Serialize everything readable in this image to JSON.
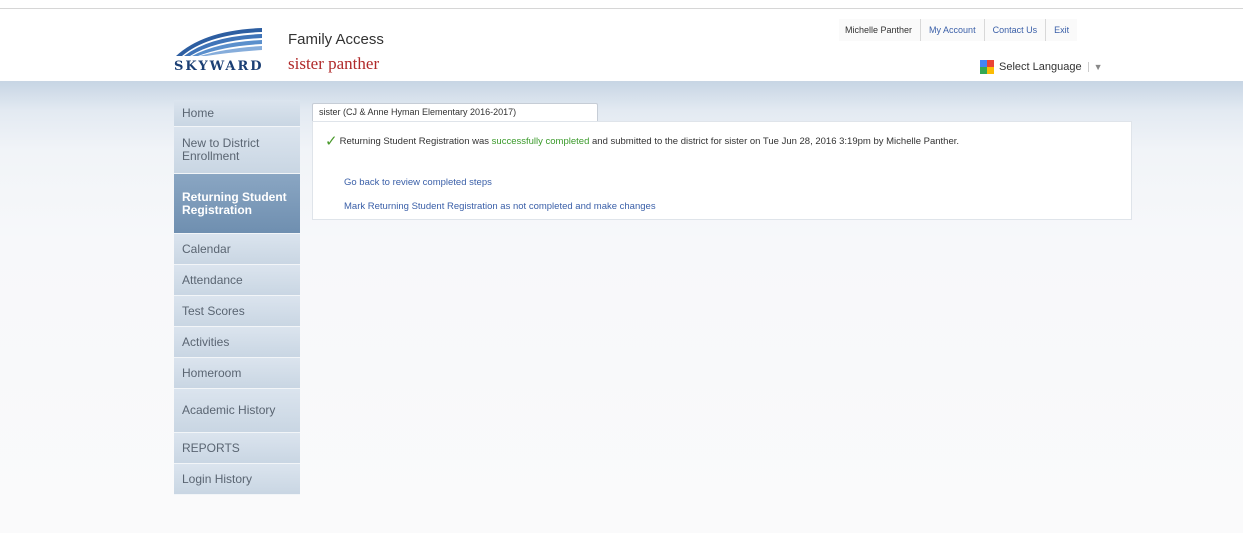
{
  "header": {
    "logo_text": "SKYWARD",
    "app_title": "Family Access",
    "student_name": "sister panther",
    "user_name": "Michelle Panther",
    "links": [
      "My Account",
      "Contact Us",
      "Exit"
    ],
    "language_label": "Select Language",
    "language_arrow": "▼"
  },
  "sidebar": {
    "items": [
      {
        "label": "Home",
        "active": false
      },
      {
        "label": "New to District Enrollment",
        "active": false
      },
      {
        "label": "Returning Student Registration",
        "active": true
      },
      {
        "label": "Calendar",
        "active": false
      },
      {
        "label": "Attendance",
        "active": false
      },
      {
        "label": "Test Scores",
        "active": false
      },
      {
        "label": "Activities",
        "active": false
      },
      {
        "label": "Homeroom",
        "active": false
      },
      {
        "label": "Academic History",
        "active": false
      },
      {
        "label": "REPORTS",
        "active": false
      },
      {
        "label": "Login History",
        "active": false
      }
    ]
  },
  "content": {
    "tab_label": "sister (CJ & Anne Hyman Elementary 2016-2017)",
    "message_prefix": "Returning Student Registration was ",
    "message_success": "successfully completed",
    "message_suffix": " and submitted to the district for sister on Tue Jun 28, 2016 3:19pm by Michelle Panther.",
    "actions": [
      "Go back to review completed steps",
      "Mark Returning Student Registration as not completed and make changes"
    ]
  },
  "colors": {
    "accent": "#3a5fa8",
    "success": "#3a9a2a",
    "student_name": "#b02a2a",
    "active_nav": "#7d9bba"
  }
}
